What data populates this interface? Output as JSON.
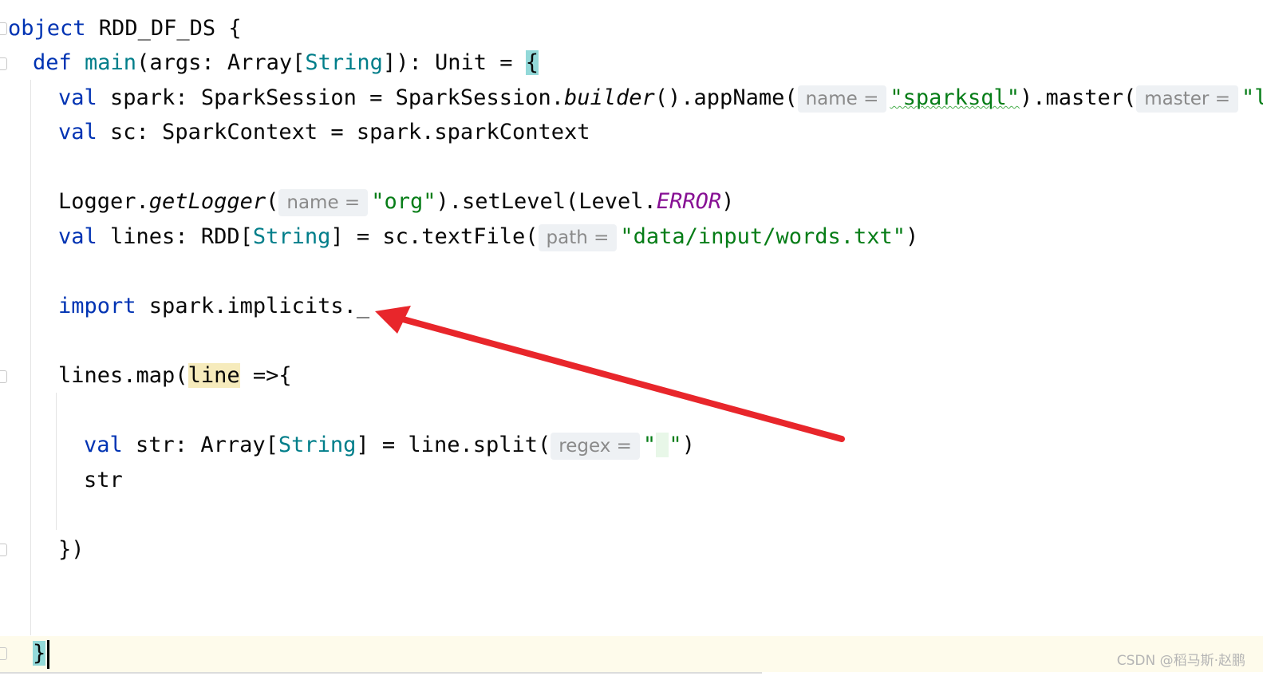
{
  "code": {
    "l1": {
      "kw": "object",
      "rest": " RDD_DF_DS {"
    },
    "l2": {
      "kw": "def",
      "name": " main",
      "a": "(args: Array[",
      "type": "String",
      "b": "]): Unit = ",
      "brace": "{"
    },
    "l3": {
      "kw": "val",
      "a": " spark: SparkSession = SparkSession.",
      "m": "builder",
      "b": "().appName(",
      "hint1": "name =",
      "s1": "\"sparksql\"",
      "c": ").master(",
      "hint2": "master =",
      "s2": "\"lo"
    },
    "l4": {
      "kw": "val",
      "a": " sc: SparkContext = spark.sparkContext"
    },
    "l5": {
      "a": "Logger.",
      "m": "getLogger",
      "b": "(",
      "hint": "name =",
      "s": "\"org\"",
      "c": ").setLevel(Level.",
      "const": "ERROR",
      "d": ")"
    },
    "l6": {
      "kw": "val",
      "a": " lines: RDD[",
      "type": "String",
      "b": "] = sc.textFile(",
      "hint": "path =",
      "s": "\"data/input/words.txt\"",
      "c": ")"
    },
    "l7": {
      "kw": "import",
      "a": " spark.implicits._"
    },
    "l8": {
      "a": "lines.map(",
      "ref": "line",
      "b": " =>{"
    },
    "l9": {
      "kw": "val",
      "a": " str: Array[",
      "type": "String",
      "b": "] = line.split(",
      "hint": "regex =",
      "s1": "\"",
      "s2": " ",
      "s3": "\"",
      "c": ")"
    },
    "l10": {
      "a": "str"
    },
    "l11": {
      "a": "})"
    },
    "l12": {
      "a": "}"
    }
  },
  "watermark": "CSDN @稻马斯·赵鹏"
}
